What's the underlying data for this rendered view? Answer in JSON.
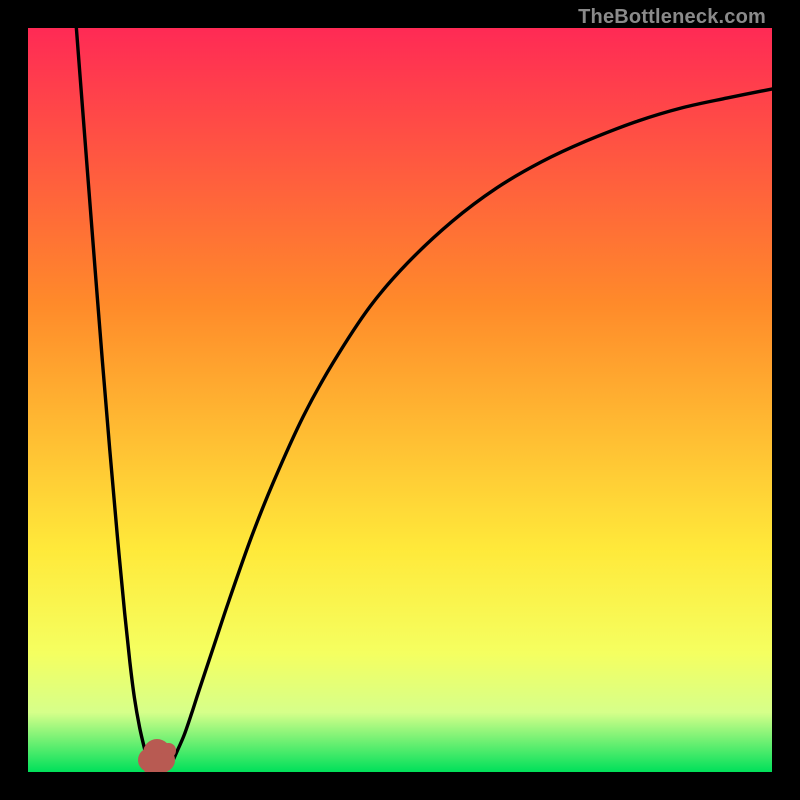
{
  "watermark": "TheBottleneck.com",
  "colors": {
    "bg": "#000000",
    "grad_top": "#ff2a55",
    "grad_mid1": "#ff8a2a",
    "grad_mid2": "#ffe93a",
    "grad_mid3": "#f5ff60",
    "grad_mid4": "#d6ff8a",
    "grad_bottom": "#00e05a",
    "curve": "#000000",
    "marker": "#b85a52"
  },
  "chart_data": {
    "type": "line",
    "title": "",
    "xlabel": "",
    "ylabel": "",
    "xlim": [
      0,
      100
    ],
    "ylim": [
      0,
      100
    ],
    "series": [
      {
        "name": "left-branch",
        "x": [
          6.5,
          7.0,
          8.0,
          9.0,
          10.0,
          11.0,
          12.0,
          13.0,
          13.7,
          14.3,
          15.0,
          15.7,
          16.0,
          16.3,
          16.5
        ],
        "values": [
          100,
          93.5,
          80.6,
          67.8,
          55.2,
          43.2,
          31.8,
          21.3,
          14.7,
          10.0,
          6.0,
          3.0,
          2.0,
          1.3,
          0.9
        ]
      },
      {
        "name": "right-branch",
        "x": [
          19.0,
          19.5,
          20.0,
          21.0,
          22.0,
          23.0,
          25.0,
          27.0,
          30.0,
          33.0,
          37.0,
          41.0,
          46.0,
          51.0,
          57.0,
          63.0,
          69.0,
          75.0,
          82.0,
          88.0,
          94.0,
          100.0
        ],
        "values": [
          0.9,
          1.6,
          2.7,
          5.0,
          7.9,
          11.0,
          17.0,
          23.0,
          31.5,
          39.0,
          47.8,
          55.0,
          62.6,
          68.4,
          74.0,
          78.5,
          82.0,
          84.8,
          87.5,
          89.3,
          90.6,
          91.8
        ]
      },
      {
        "name": "bottom-blob",
        "x": [
          16.5,
          16.7,
          17.0,
          17.4,
          17.8,
          18.2,
          18.6,
          19.0
        ],
        "values": [
          0.9,
          0.6,
          0.5,
          0.5,
          0.5,
          0.6,
          0.75,
          0.9
        ]
      }
    ],
    "markers": [
      {
        "x": 17.3,
        "y": 2.5,
        "r": 1.9
      },
      {
        "x": 16.4,
        "y": 1.6,
        "r": 1.6
      },
      {
        "x": 18.1,
        "y": 1.6,
        "r": 1.6
      },
      {
        "x": 17.2,
        "y": 0.95,
        "r": 1.7
      },
      {
        "x": 18.9,
        "y": 2.9,
        "r": 1.0
      }
    ]
  }
}
